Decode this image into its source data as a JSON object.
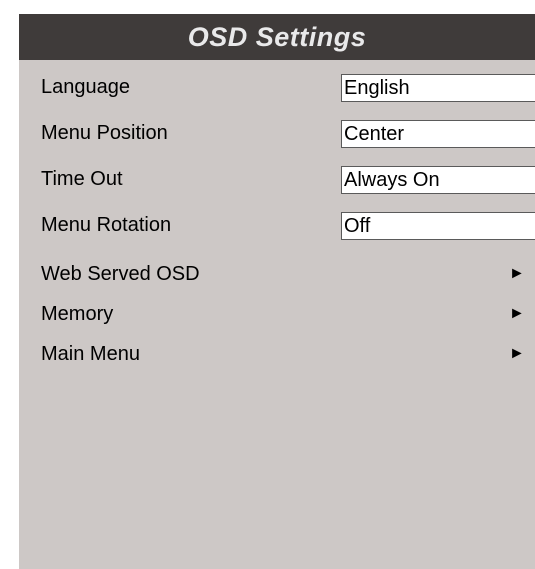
{
  "header": {
    "title": "OSD Settings"
  },
  "settings": [
    {
      "label": "Language",
      "value": "English"
    },
    {
      "label": "Menu Position",
      "value": "Center"
    },
    {
      "label": "Time Out",
      "value": "Always On"
    },
    {
      "label": "Menu Rotation",
      "value": "Off"
    }
  ],
  "submenus": [
    {
      "label": "Web Served OSD",
      "icon": "right-arrow-icon"
    },
    {
      "label": "Memory",
      "icon": "right-arrow-icon"
    },
    {
      "label": "Main Menu",
      "icon": "right-arrow-icon"
    }
  ],
  "arrow_glyph": "►",
  "colors": {
    "header_bg": "#3f3b3a",
    "header_text": "#e9e9ea",
    "panel_bg": "#cdc8c6",
    "field_bg": "#ffffff"
  }
}
